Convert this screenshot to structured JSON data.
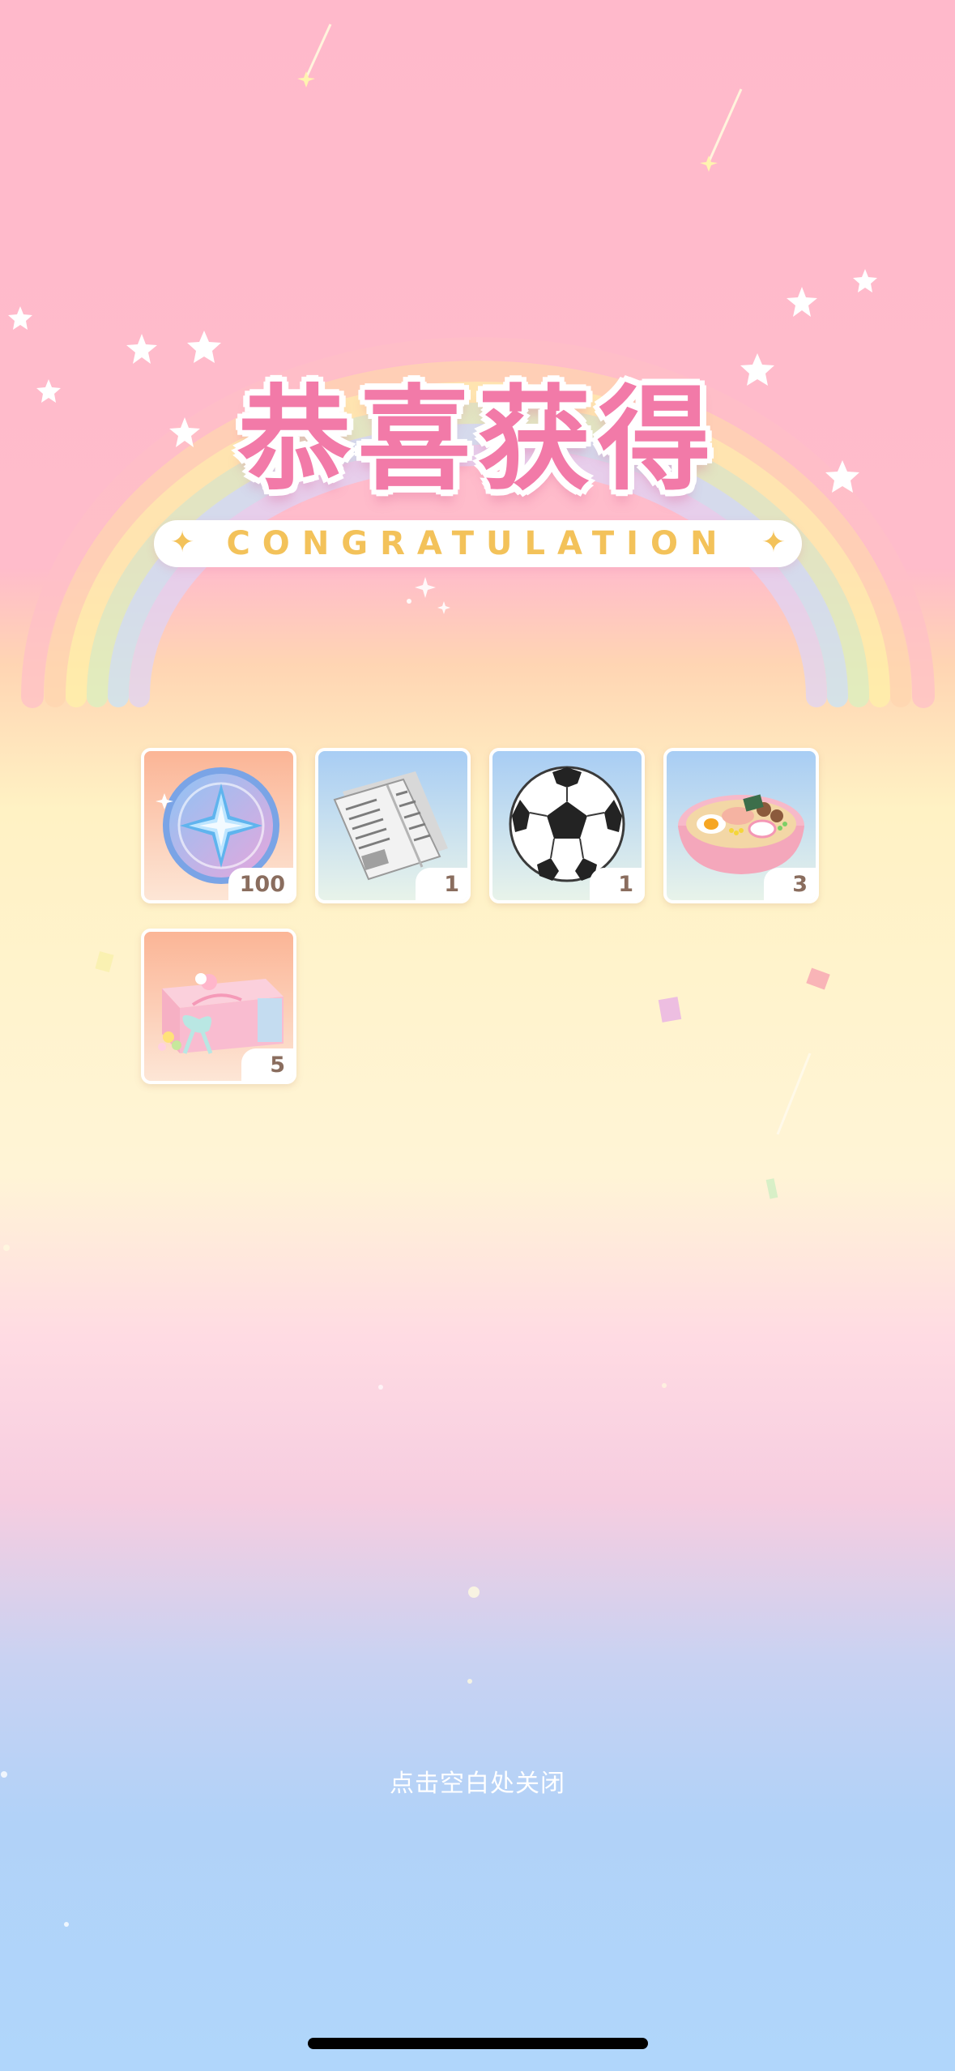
{
  "title": {
    "main": "恭喜获得",
    "subtitle": "CONGRATULATION"
  },
  "rewards": [
    {
      "name": "star-coin",
      "icon": "star-coin-icon",
      "count": "100"
    },
    {
      "name": "newspaper",
      "icon": "newspaper-icon",
      "count": "1"
    },
    {
      "name": "soccer-ball",
      "icon": "soccer-ball-icon",
      "count": "1"
    },
    {
      "name": "ramen-bowl",
      "icon": "ramen-bowl-icon",
      "count": "3"
    },
    {
      "name": "gift-box",
      "icon": "gift-box-icon",
      "count": "5"
    }
  ],
  "close_hint": "点击空白处关闭",
  "colors": {
    "title_pink": "#f27aa8",
    "subtitle_gold": "#f3c25a",
    "count_text": "#8a6d5e"
  }
}
